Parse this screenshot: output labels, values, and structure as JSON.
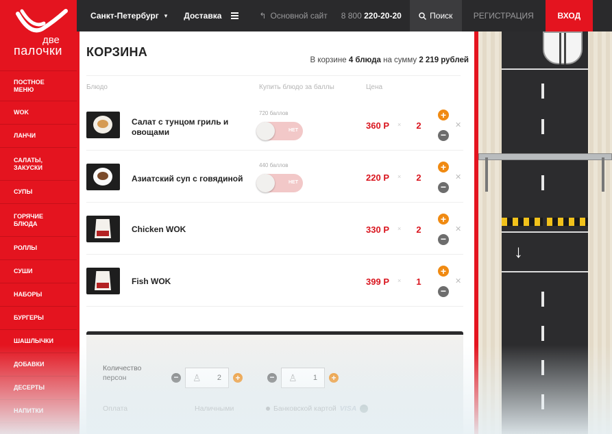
{
  "brand": {
    "line1": "две",
    "line2": "палочки",
    "color": "#e4141f"
  },
  "sidebar": {
    "items": [
      {
        "label": "Постное меню"
      },
      {
        "label": "WOK"
      },
      {
        "label": "Ланчи"
      },
      {
        "label": "Салаты, закуски"
      },
      {
        "label": "Супы"
      },
      {
        "label": "Горячие блюда"
      },
      {
        "label": "Роллы"
      },
      {
        "label": "Суши"
      },
      {
        "label": "Наборы"
      },
      {
        "label": "Бургеры"
      },
      {
        "label": "Шашлычки"
      },
      {
        "label": "Добавки"
      },
      {
        "label": "Десерты"
      },
      {
        "label": "Напитки"
      }
    ]
  },
  "topbar": {
    "city": "Санкт-Петербург",
    "delivery": "Доставка",
    "main_site": "Основной сайт",
    "phone_prefix": "8 800",
    "phone_number": "220-20-20",
    "search": "Поиск",
    "register": "РЕГИСТРАЦИЯ",
    "login": "ВХОД"
  },
  "cart": {
    "title": "КОРЗИНА",
    "summary_prefix": "В корзине",
    "summary_count": "4 блюда",
    "summary_mid": "на сумму",
    "summary_total": "2 219 рублей",
    "columns": {
      "dish": "Блюдо",
      "points": "Купить блюдо за баллы",
      "price": "Цена"
    },
    "items": [
      {
        "name": "Салат с тунцом гриль и овощами",
        "points": "720 баллов",
        "toggle": "НЕТ",
        "price": "360 Р",
        "qty": "2",
        "thumb": "salad"
      },
      {
        "name": "Азиатский суп с говядиной",
        "points": "440 баллов",
        "toggle": "НЕТ",
        "price": "220 Р",
        "qty": "2",
        "thumb": "soup"
      },
      {
        "name": "Chicken WOK",
        "points": "",
        "toggle": "",
        "price": "330 Р",
        "qty": "2",
        "thumb": "wok"
      },
      {
        "name": "Fish WOK",
        "points": "",
        "toggle": "",
        "price": "399 Р",
        "qty": "1",
        "thumb": "wok"
      }
    ]
  },
  "order": {
    "persons_label": "Количество персон",
    "adults": "2",
    "kids": "1",
    "payment_label": "Оплата",
    "cash": "Наличными",
    "card": "Банковской картой",
    "visa": "VISA"
  },
  "accent_orange": "#f08a12",
  "topbar_bg": "#2a2a2c"
}
